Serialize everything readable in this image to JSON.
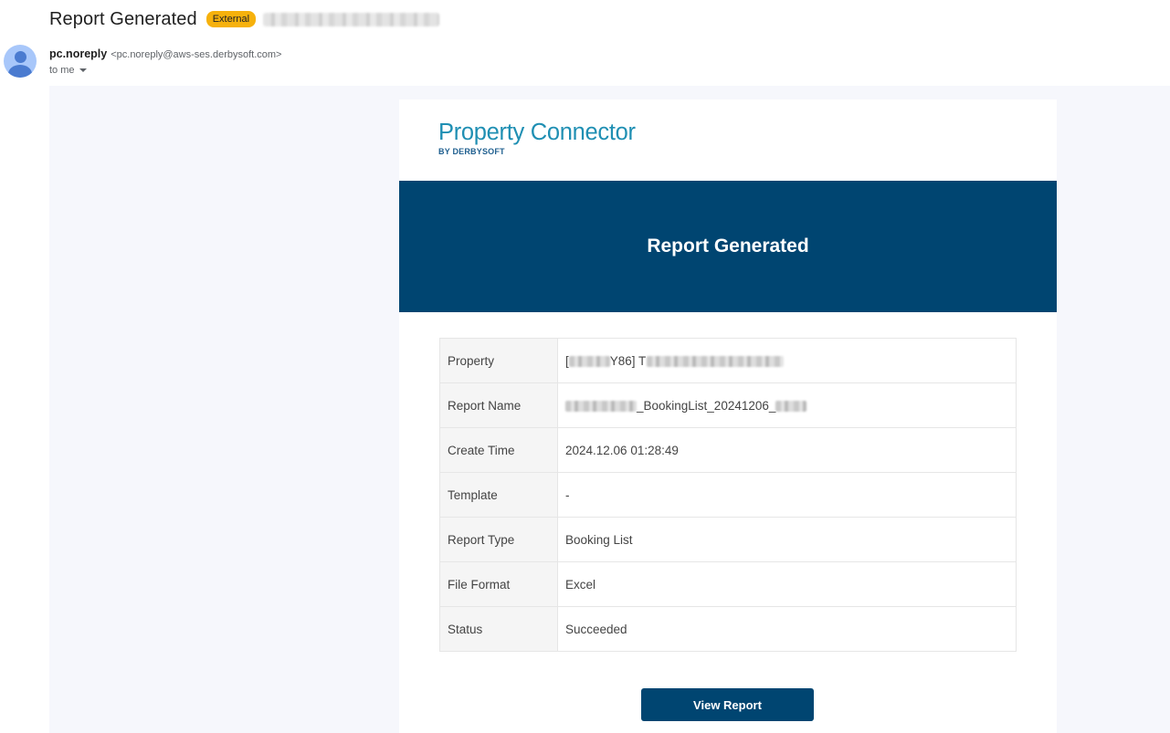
{
  "email": {
    "subject": "Report Generated",
    "badge": "External",
    "sender_name": "pc.noreply",
    "sender_email": "<pc.noreply@aws-ses.derbysoft.com>",
    "recipient": "to me"
  },
  "logo": {
    "name": "Property Connector",
    "tagline": "BY DERBYSOFT"
  },
  "banner": {
    "title": "Report Generated"
  },
  "details": [
    {
      "label": "Property",
      "value_prefix": "[",
      "value_visible": "Y86",
      "value_mid": "] T",
      "value_suffix": ""
    },
    {
      "label": "Report Name",
      "value_prefix": "",
      "value_visible": "_BookingList_20241206_",
      "value_mid": "",
      "value_suffix": ""
    },
    {
      "label": "Create Time",
      "value": "2024.12.06 01:28:49"
    },
    {
      "label": "Template",
      "value": "-"
    },
    {
      "label": "Report Type",
      "value": "Booking List"
    },
    {
      "label": "File Format",
      "value": "Excel"
    },
    {
      "label": "Status",
      "value": "Succeeded"
    }
  ],
  "actions": {
    "view_report": "View Report"
  },
  "colors": {
    "banner": "#004571",
    "badge": "#f6b10c",
    "logo": "#1f8fb3"
  },
  "icons": [
    "avatar-icon",
    "chevron-down-icon"
  ]
}
